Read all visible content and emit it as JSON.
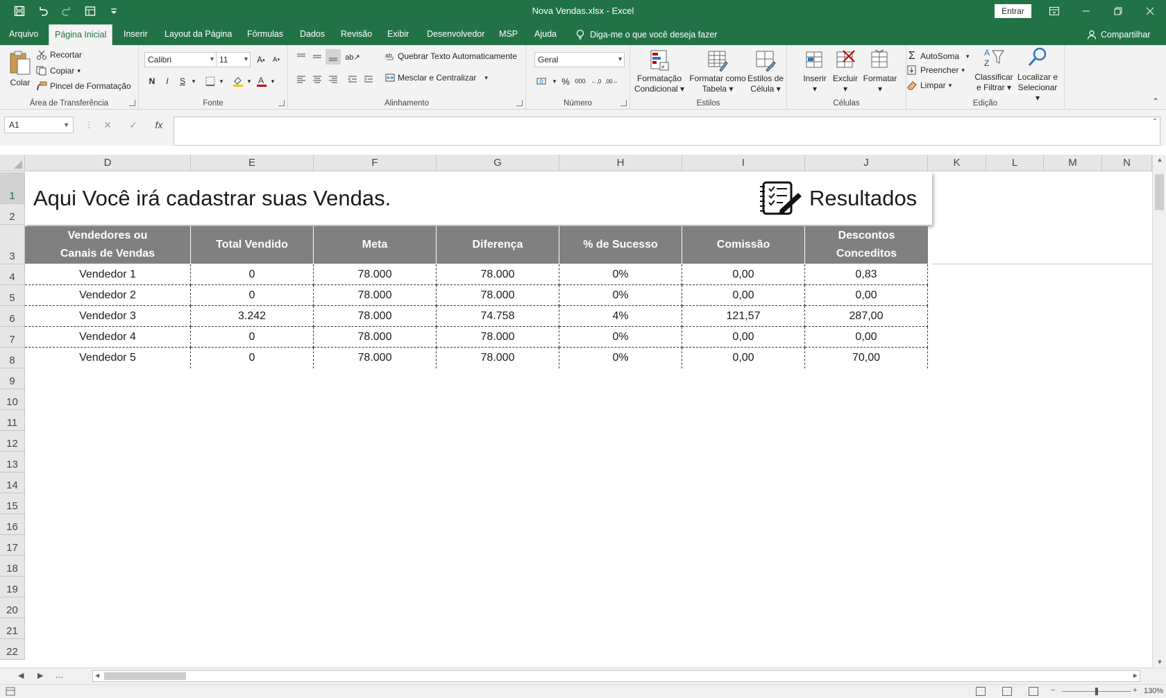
{
  "window": {
    "title": "Nova Vendas.xlsx  -  Excel",
    "signin_label": "Entrar"
  },
  "tabs": {
    "file": "Arquivo",
    "home": "Página Inicial",
    "insert": "Inserir",
    "layout": "Layout da Página",
    "formulas": "Fórmulas",
    "data": "Dados",
    "review": "Revisão",
    "view": "Exibir",
    "developer": "Desenvolvedor",
    "msp": "MSP",
    "help": "Ajuda",
    "tellme": "Diga-me o que você deseja fazer",
    "share": "Compartilhar"
  },
  "ribbon": {
    "clipboard": {
      "paste": "Colar",
      "cut": "Recortar",
      "copy": "Copiar",
      "format_painter": "Pincel de Formatação",
      "label": "Área de Transferência"
    },
    "font": {
      "name": "Calibri",
      "size": "11",
      "bold": "N",
      "italic": "I",
      "underline": "S",
      "label": "Fonte"
    },
    "alignment": {
      "wrap": "Quebrar Texto Automaticamente",
      "merge": "Mesclar e Centralizar",
      "label": "Alinhamento"
    },
    "number": {
      "format": "Geral",
      "label": "Número"
    },
    "styles": {
      "conditional_1": "Formatação",
      "conditional_2": "Condicional",
      "table_1": "Formatar como",
      "table_2": "Tabela",
      "cell_1": "Estilos de",
      "cell_2": "Célula",
      "label": "Estilos"
    },
    "cells": {
      "insert": "Inserir",
      "delete": "Excluir",
      "format": "Formatar",
      "label": "Células"
    },
    "editing": {
      "autosum": "AutoSoma",
      "fill": "Preencher",
      "clear": "Limpar",
      "sort_1": "Classificar",
      "sort_2": "e Filtrar",
      "find_1": "Localizar e",
      "find_2": "Selecionar",
      "label": "Edição"
    }
  },
  "formula_bar": {
    "name_box": "A1",
    "fx": "fx",
    "content": ""
  },
  "columns": [
    "D",
    "E",
    "F",
    "G",
    "H",
    "I",
    "J",
    "K",
    "L",
    "M",
    "N"
  ],
  "rows": [
    "1",
    "2",
    "3",
    "4",
    "5",
    "6",
    "7",
    "8",
    "9",
    "10",
    "11",
    "12",
    "13",
    "14",
    "15",
    "16",
    "17",
    "18",
    "19",
    "20",
    "21",
    "22"
  ],
  "banner": {
    "title": "Aqui Você irá cadastrar suas Vendas.",
    "results": "Resultados"
  },
  "table": {
    "headers": [
      [
        "Vendedores ou",
        "Canais de Vendas"
      ],
      [
        "Total Vendido"
      ],
      [
        "Meta"
      ],
      [
        "Diferença"
      ],
      [
        "% de Sucesso"
      ],
      [
        "Comissão"
      ],
      [
        "Descontos",
        "Conceditos"
      ]
    ],
    "rows": [
      [
        "Vendedor 1",
        "0",
        "78.000",
        "78.000",
        "0%",
        "0,00",
        "0,83"
      ],
      [
        "Vendedor 2",
        "0",
        "78.000",
        "78.000",
        "0%",
        "0,00",
        "0,00"
      ],
      [
        "Vendedor 3",
        "3.242",
        "78.000",
        "74.758",
        "4%",
        "121,57",
        "287,00"
      ],
      [
        "Vendedor 4",
        "0",
        "78.000",
        "78.000",
        "0%",
        "0,00",
        "0,00"
      ],
      [
        "Vendedor 5",
        "0",
        "78.000",
        "78.000",
        "0%",
        "0,00",
        "70,00"
      ]
    ]
  },
  "sheetbar": {
    "more": "..."
  },
  "status": {
    "zoom": "130%"
  },
  "colors": {
    "accent": "#217346",
    "header_fill": "#808080"
  }
}
